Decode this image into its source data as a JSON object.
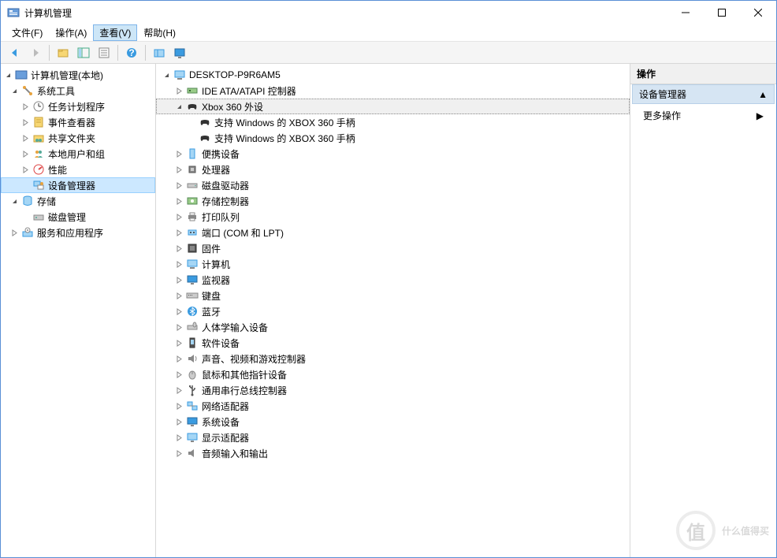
{
  "window": {
    "title": "计算机管理",
    "min": "—",
    "max": "☐",
    "close": "✕"
  },
  "menu": {
    "file": "文件(F)",
    "action": "操作(A)",
    "view": "查看(V)",
    "help": "帮助(H)"
  },
  "leftTree": {
    "root": "计算机管理(本地)",
    "systemTools": "系统工具",
    "systemToolsItems": {
      "taskScheduler": "任务计划程序",
      "eventViewer": "事件查看器",
      "sharedFolders": "共享文件夹",
      "localUsers": "本地用户和组",
      "performance": "性能",
      "deviceManager": "设备管理器"
    },
    "storage": "存储",
    "storageItems": {
      "diskMgmt": "磁盘管理"
    },
    "services": "服务和应用程序"
  },
  "centerTree": {
    "root": "DESKTOP-P9R6AM5",
    "ide": "IDE ATA/ATAPI 控制器",
    "xbox": "Xbox 360 外设",
    "xboxChild1": "支持 Windows 的 XBOX 360 手柄",
    "xboxChild2": "支持 Windows 的 XBOX 360 手柄",
    "portable": "便携设备",
    "processor": "处理器",
    "diskDrive": "磁盘驱动器",
    "storageCtrl": "存储控制器",
    "printQueue": "打印队列",
    "ports": "端口 (COM 和 LPT)",
    "firmware": "固件",
    "computer": "计算机",
    "monitor": "监视器",
    "keyboard": "键盘",
    "bluetooth": "蓝牙",
    "hid": "人体学输入设备",
    "software": "软件设备",
    "sound": "声音、视频和游戏控制器",
    "mouse": "鼠标和其他指针设备",
    "usb": "通用串行总线控制器",
    "network": "网络适配器",
    "systemDev": "系统设备",
    "display": "显示适配器",
    "audio": "音频输入和输出"
  },
  "rightPane": {
    "header": "操作",
    "section": "设备管理器",
    "moreActions": "更多操作"
  },
  "watermark": {
    "zhi": "值",
    "text": "什么值得买"
  }
}
